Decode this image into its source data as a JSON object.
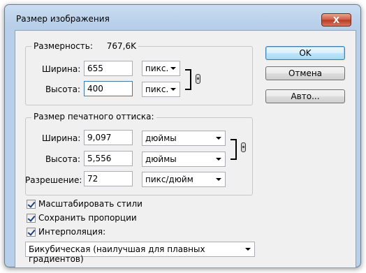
{
  "window": {
    "title": "Размер изображения",
    "close_label": "X"
  },
  "buttons": {
    "ok": "OK",
    "cancel": "Отмена",
    "auto": "Авто..."
  },
  "pixel_dims": {
    "legend": "Размерность:",
    "size_value": "767,6K",
    "width_label": "Ширина:",
    "width_value": "655",
    "width_unit": "пикс.",
    "height_label": "Высота:",
    "height_value": "400",
    "height_unit": "пикс."
  },
  "print_size": {
    "legend": "Размер печатного оттиска:",
    "width_label": "Ширина:",
    "width_value": "9,097",
    "width_unit": "дюймы",
    "height_label": "Высота:",
    "height_value": "5,556",
    "height_unit": "дюймы",
    "resolution_label": "Разрешение:",
    "resolution_value": "72",
    "resolution_unit": "пикс/дюйм"
  },
  "options": {
    "scale_styles": {
      "label": "Масштабировать стили",
      "checked": true
    },
    "constrain": {
      "label": "Сохранить пропорции",
      "checked": true
    },
    "resample": {
      "label": "Интерполяция:",
      "checked": true
    },
    "method": "Бикубическая (наилучшая для плавных градиентов)"
  },
  "icons": {
    "link": "chain-link-icon",
    "dropdown": "chevron-down-icon"
  }
}
